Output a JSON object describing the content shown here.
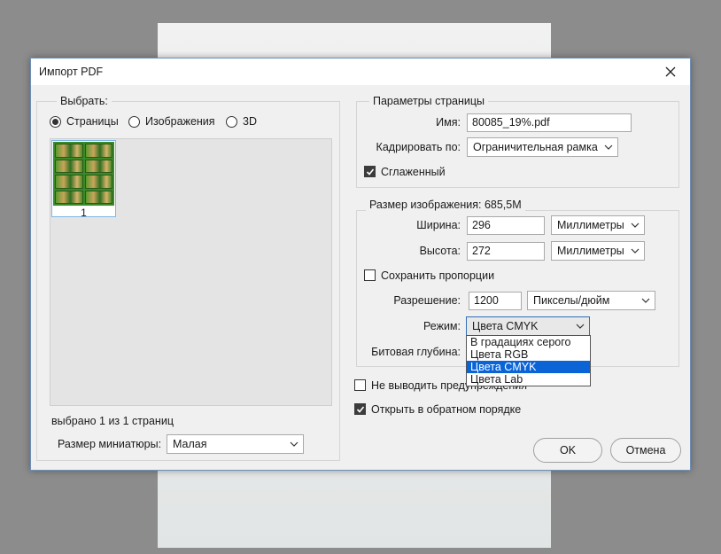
{
  "dialog": {
    "title": "Импорт PDF",
    "close_icon": "close-icon"
  },
  "left": {
    "legend": "Выбрать:",
    "radios": [
      {
        "label": "Страницы",
        "checked": true
      },
      {
        "label": "Изображения",
        "checked": false
      },
      {
        "label": "3D",
        "checked": false
      }
    ],
    "thumb_number": "1",
    "status": "выбрано 1 из 1 страниц",
    "thumb_size_label": "Размер миниатюры:",
    "thumb_size_value": "Малая"
  },
  "page_params": {
    "legend": "Параметры страницы",
    "name_label": "Имя:",
    "name_value": "80085_19%.pdf",
    "crop_label": "Кадрировать по:",
    "crop_value": "Ограничительная рамка",
    "smooth_label": "Сглаженный",
    "smooth_checked": true
  },
  "image_size": {
    "legend": "Размер изображения: 685,5M",
    "width_label": "Ширина:",
    "width_value": "296",
    "width_unit": "Миллиметры",
    "height_label": "Высота:",
    "height_value": "272",
    "height_unit": "Миллиметры",
    "keep_ratio_label": "Сохранить пропорции",
    "keep_ratio_checked": false,
    "resolution_label": "Разрешение:",
    "resolution_value": "1200",
    "resolution_unit": "Пикселы/дюйм",
    "mode_label": "Режим:",
    "mode_value": "Цвета CMYK",
    "bitdepth_label": "Битовая глубина:"
  },
  "mode_dropdown": {
    "options": [
      "В градациях серого",
      "Цвета RGB",
      "Цвета CMYK",
      "Цвета Lab"
    ],
    "selected_index": 2
  },
  "options": {
    "suppress_label": "Не выводить предупреждения",
    "suppress_checked": false,
    "reverse_label": "Открыть в обратном порядке",
    "reverse_checked": true
  },
  "buttons": {
    "ok": "OK",
    "cancel": "Отмена"
  },
  "colors": {
    "selection": "#0a64d6",
    "focus_border": "#2f6fb5",
    "thumb_border": "#7fb7e6"
  }
}
